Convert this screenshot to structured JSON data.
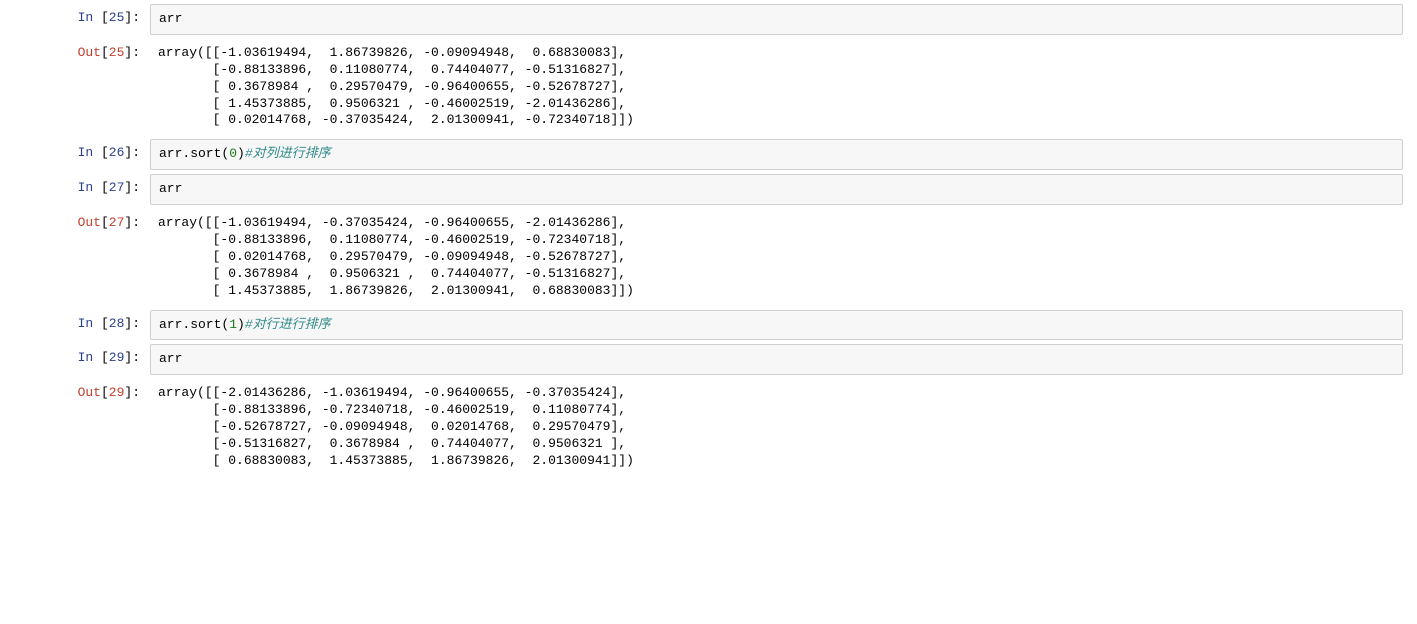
{
  "cells": [
    {
      "prompt_kw": "In",
      "prompt_num": "25",
      "type": "in",
      "code_html": "arr"
    },
    {
      "prompt_kw": "Out",
      "prompt_num": "25",
      "type": "out",
      "code_html": "array([[-1.03619494,  1.86739826, -0.09094948,  0.68830083],\n       [-0.88133896,  0.11080774,  0.74404077, -0.51316827],\n       [ 0.3678984 ,  0.29570479, -0.96400655, -0.52678727],\n       [ 1.45373885,  0.9506321 , -0.46002519, -2.01436286],\n       [ 0.02014768, -0.37035424,  2.01300941, -0.72340718]])"
    },
    {
      "prompt_kw": "In",
      "prompt_num": "26",
      "type": "in",
      "code_html": "arr.sort<span class=\"tok-paren\">(</span><span class=\"tok-num\">0</span><span class=\"tok-paren\">)</span><span class=\"tok-comment\">#对列进行排序</span>"
    },
    {
      "prompt_kw": "In",
      "prompt_num": "27",
      "type": "in",
      "code_html": "arr"
    },
    {
      "prompt_kw": "Out",
      "prompt_num": "27",
      "type": "out",
      "code_html": "array([[-1.03619494, -0.37035424, -0.96400655, -2.01436286],\n       [-0.88133896,  0.11080774, -0.46002519, -0.72340718],\n       [ 0.02014768,  0.29570479, -0.09094948, -0.52678727],\n       [ 0.3678984 ,  0.9506321 ,  0.74404077, -0.51316827],\n       [ 1.45373885,  1.86739826,  2.01300941,  0.68830083]])"
    },
    {
      "prompt_kw": "In",
      "prompt_num": "28",
      "type": "in",
      "code_html": "arr.sort<span class=\"tok-paren\">(</span><span class=\"tok-num\">1</span><span class=\"tok-paren\">)</span><span class=\"tok-comment\">#对行进行排序</span>"
    },
    {
      "prompt_kw": "In",
      "prompt_num": "29",
      "type": "in",
      "code_html": "arr"
    },
    {
      "prompt_kw": "Out",
      "prompt_num": "29",
      "type": "out",
      "code_html": "array([[-2.01436286, -1.03619494, -0.96400655, -0.37035424],\n       [-0.88133896, -0.72340718, -0.46002519,  0.11080774],\n       [-0.52678727, -0.09094948,  0.02014768,  0.29570479],\n       [-0.51316827,  0.3678984 ,  0.74404077,  0.9506321 ],\n       [ 0.68830083,  1.45373885,  1.86739826,  2.01300941]])"
    }
  ]
}
